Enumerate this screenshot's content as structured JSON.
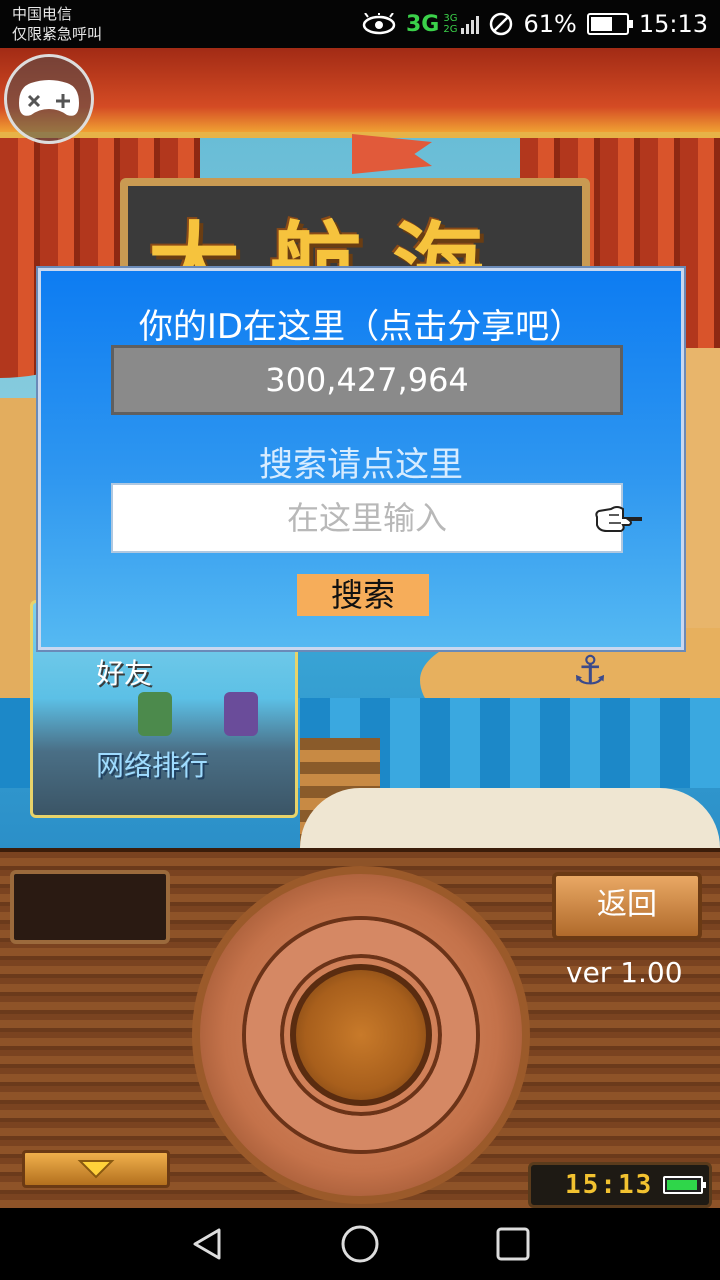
{
  "status_bar": {
    "carrier_line1": "中国电信",
    "carrier_line2": "仅限紧急呼叫",
    "network": "3G",
    "network_small_1": "3G",
    "network_small_2": "2G",
    "battery": "61%",
    "battery_level": 0.61,
    "time": "15:13"
  },
  "scene": {
    "title_sign": "大航海",
    "friends_label": "好友",
    "ranking_label": "网络排行"
  },
  "dialog": {
    "title": "你的ID在这里（点击分享吧）",
    "player_id": "300,427,964",
    "search_title": "搜索请点这里",
    "search_placeholder": "在这里输入",
    "search_value": "",
    "search_button": "搜索"
  },
  "panel": {
    "back_button": "返回",
    "version": "ver 1.00",
    "clock": "15:13"
  },
  "icons": {
    "gamepad": "gamepad-icon",
    "pointer": "pointing-hand-icon",
    "down": "down-arrow-icon",
    "nav_back": "triangle-back-icon",
    "nav_home": "circle-home-icon",
    "nav_recent": "square-recent-icon"
  },
  "colors": {
    "dialog_blue": "#0d7cf2",
    "button_orange": "#f6ad5a",
    "clock_yellow": "#f2c230"
  }
}
